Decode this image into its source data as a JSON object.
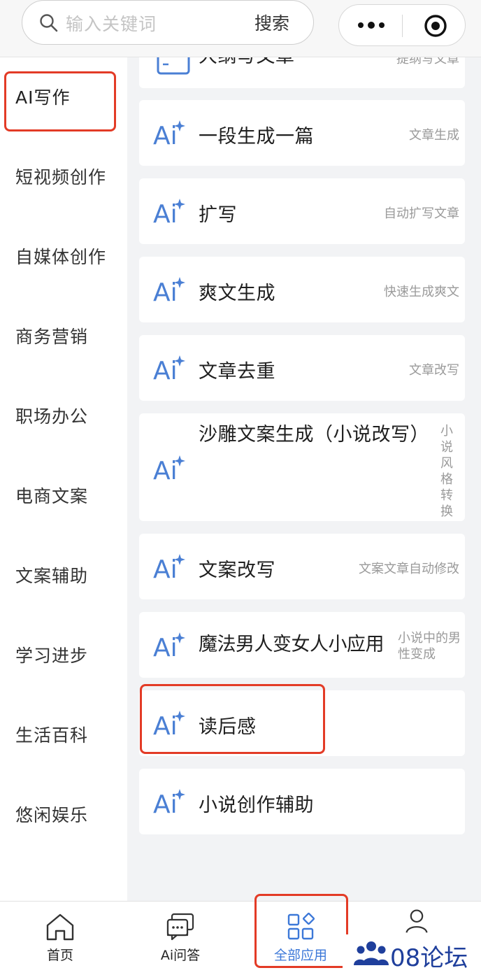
{
  "search": {
    "placeholder": "输入关键词",
    "button": "搜索"
  },
  "capsule": {
    "more_icon": "more-dots-icon",
    "target_icon": "target-icon"
  },
  "sidebar": {
    "items": [
      {
        "label": "AI写作",
        "active": true
      },
      {
        "label": "短视频创作"
      },
      {
        "label": "自媒体创作"
      },
      {
        "label": "商务营销"
      },
      {
        "label": "职场办公"
      },
      {
        "label": "电商文案"
      },
      {
        "label": "文案辅助"
      },
      {
        "label": "学习进步"
      },
      {
        "label": "生活百科"
      },
      {
        "label": "悠闲娱乐"
      }
    ]
  },
  "apps": [
    {
      "title": "大纲写文章",
      "subtitle": "提纲写文章"
    },
    {
      "title": "一段生成一篇",
      "subtitle": "文章生成"
    },
    {
      "title": "扩写",
      "subtitle": "自动扩写文章"
    },
    {
      "title": "爽文生成",
      "subtitle": "快速生成爽文"
    },
    {
      "title": "文章去重",
      "subtitle": "文章改写"
    },
    {
      "title": "沙雕文案生成（小说改写）",
      "subtitle": "小说风格转换"
    },
    {
      "title": "文案改写",
      "subtitle": "文案文章自动修改"
    },
    {
      "title": "魔法男人变女人小应用",
      "subtitle": "小说中的男性变成"
    },
    {
      "title": "读后感",
      "subtitle": ""
    },
    {
      "title": "小说创作辅助",
      "subtitle": ""
    }
  ],
  "tabbar": {
    "tabs": [
      {
        "label": "首页",
        "icon": "home-icon"
      },
      {
        "label": "Ai问答",
        "icon": "chat-icon"
      },
      {
        "label": "全部应用",
        "icon": "apps-grid-icon",
        "active": true
      },
      {
        "label": "",
        "icon": "user-icon"
      }
    ]
  },
  "watermark": {
    "text": "08论坛"
  },
  "colors": {
    "accent": "#3c78d8",
    "highlight_box": "#e33b26",
    "ai_icon": "#4a7fd4"
  }
}
